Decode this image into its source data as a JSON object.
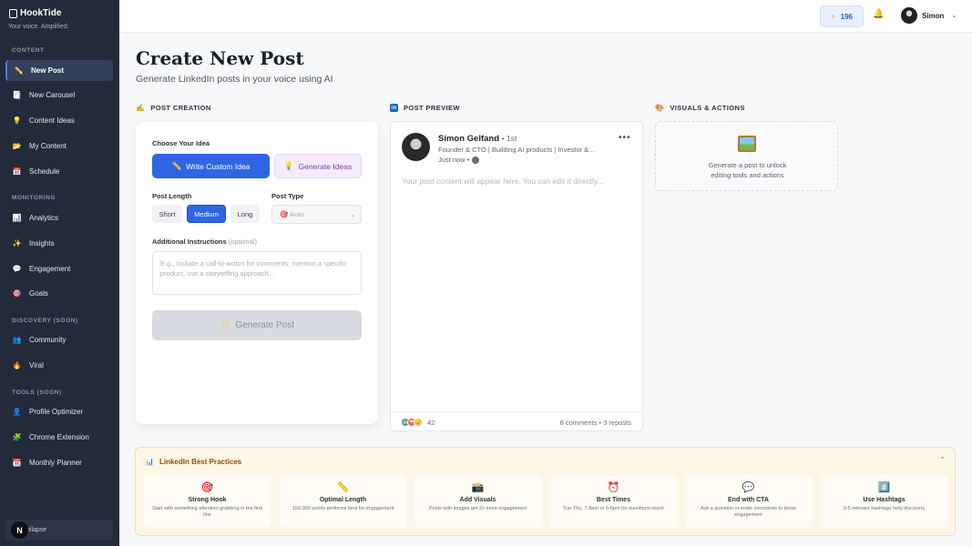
{
  "brand": {
    "name": "HookTide",
    "tagline": "Your voice. Amplified."
  },
  "sidebar": {
    "sections": [
      {
        "title": "CONTENT",
        "items": [
          {
            "label": "New Post",
            "icon": "pencil-icon",
            "glyph": "✏️",
            "active": true
          },
          {
            "label": "New Carousel",
            "icon": "carousel-icon",
            "glyph": "📑"
          },
          {
            "label": "Content Ideas",
            "icon": "lightbulb-icon",
            "glyph": "💡"
          },
          {
            "label": "My Content",
            "icon": "folder-icon",
            "glyph": "📂"
          },
          {
            "label": "Schedule",
            "icon": "calendar-icon",
            "glyph": "📅"
          }
        ]
      },
      {
        "title": "MONITORING",
        "items": [
          {
            "label": "Analytics",
            "icon": "chart-icon",
            "glyph": "📊"
          },
          {
            "label": "Insights",
            "icon": "sparkles-icon",
            "glyph": "✨"
          },
          {
            "label": "Engagement",
            "icon": "speech-bubble-icon",
            "glyph": "💬"
          },
          {
            "label": "Goals",
            "icon": "target-icon",
            "glyph": "🎯"
          }
        ]
      },
      {
        "title": "DISCOVERY (SOON)",
        "items": [
          {
            "label": "Community",
            "icon": "people-icon",
            "glyph": "👥"
          },
          {
            "label": "Viral",
            "icon": "fire-icon",
            "glyph": "🔥"
          }
        ]
      },
      {
        "title": "TOOLS (SOON)",
        "items": [
          {
            "label": "Profile Optimizer",
            "icon": "person-icon",
            "glyph": "👤"
          },
          {
            "label": "Chrome Extension",
            "icon": "puzzle-icon",
            "glyph": "🧩"
          },
          {
            "label": "Monthly Planner",
            "icon": "calendar-icon",
            "glyph": "📆"
          }
        ]
      }
    ],
    "collapse_label": "ollapse",
    "collapse_badge": "N"
  },
  "topbar": {
    "credits": "196",
    "user_name": "Simon"
  },
  "page": {
    "title": "Create New Post",
    "subtitle": "Generate LinkedIn posts in your voice using AI"
  },
  "creation": {
    "heading": "POST CREATION",
    "choose_label": "Choose Your Idea",
    "write_btn": "Write Custom Idea",
    "ideas_btn": "Generate Ideas",
    "length_label": "Post Length",
    "lengths": [
      "Short",
      "Medium",
      "Long"
    ],
    "length_selected": "Medium",
    "type_label": "Post Type",
    "type_value": "Auto",
    "instructions_label": "Additional Instructions",
    "instructions_optional": "(optional)",
    "instructions_placeholder": "E.g., Include a call-to-action for comments, mention a specific product, use a storytelling approach...",
    "generate_btn": "Generate Post"
  },
  "preview": {
    "heading": "POST PREVIEW",
    "name": "Simon Gelfand",
    "degree": "• 1st",
    "headline": "Founder & CTO | Building AI products | Investor &...",
    "time": "Just now •",
    "placeholder": "Your post content will appear here. You can edit it directly...",
    "reaction_count": "42",
    "stats": "8 comments • 3 reposts"
  },
  "visuals": {
    "heading": "VISUALS & ACTIONS",
    "text_line1": "Generate a post to unlock",
    "text_line2": "editing tools and actions"
  },
  "best_practices": {
    "title": "LinkedIn Best Practices",
    "cards": [
      {
        "name": "Strong Hook",
        "desc": "Start with something attention-grabbing in the first line",
        "icon": "target-icon",
        "glyph": "🎯"
      },
      {
        "name": "Optimal Length",
        "desc": "150-300 words performs best for engagement",
        "icon": "ruler-icon",
        "glyph": "📏"
      },
      {
        "name": "Add Visuals",
        "desc": "Posts with images get 2x more engagement",
        "icon": "camera-icon",
        "glyph": "📸"
      },
      {
        "name": "Best Times",
        "desc": "Tue-Thu, 7-8am or 5-6pm for maximum reach",
        "icon": "alarm-clock-icon",
        "glyph": "⏰"
      },
      {
        "name": "End with CTA",
        "desc": "Ask a question or invite comments to boost engagement",
        "icon": "speech-bubble-icon",
        "glyph": "💬"
      },
      {
        "name": "Use Hashtags",
        "desc": "3-5 relevant hashtags help discovery",
        "icon": "hashtag-icon",
        "glyph": "#️⃣"
      }
    ]
  },
  "colors": {
    "accent": "#2f66e6",
    "sidebar_bg": "#232a3a",
    "linkedin": "#0a66c2",
    "practices_bg": "#fef7e8"
  }
}
